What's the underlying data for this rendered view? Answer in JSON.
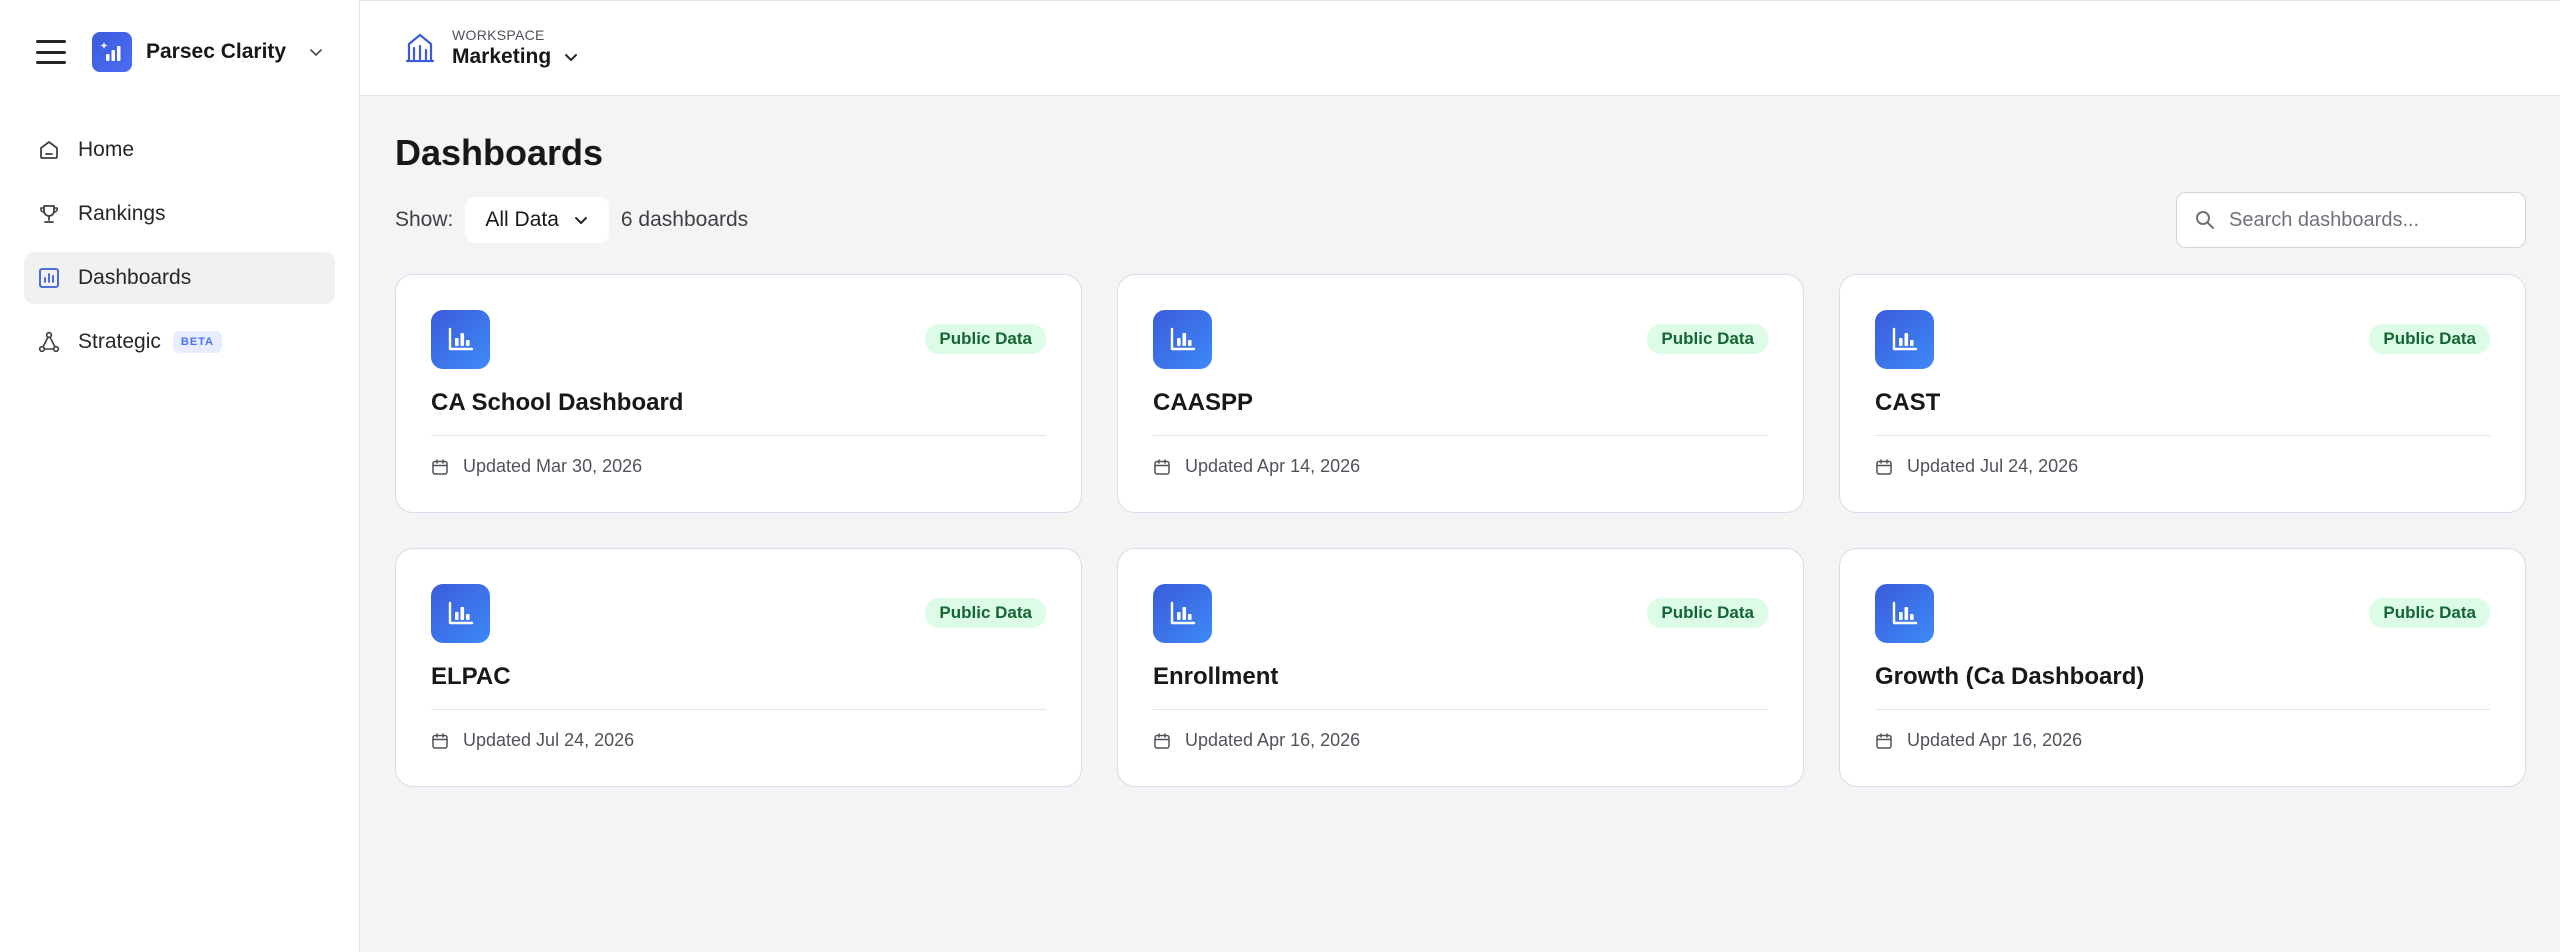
{
  "app": {
    "brand_name": "Parsec Clarity",
    "accent_color": "#4c6ef5"
  },
  "sidebar": {
    "items": [
      {
        "label": "Home",
        "icon": "home-icon",
        "active": false
      },
      {
        "label": "Rankings",
        "icon": "trophy-icon",
        "active": false
      },
      {
        "label": "Dashboards",
        "icon": "chart-icon",
        "active": true
      },
      {
        "label": "Strategic",
        "icon": "network-icon",
        "active": false,
        "badge": "BETA"
      }
    ]
  },
  "topbar": {
    "workspace_label": "WORKSPACE",
    "workspace_name": "Marketing"
  },
  "main": {
    "title": "Dashboards",
    "show_label": "Show:",
    "filter_value": "All Data",
    "count_text": "6 dashboards",
    "search_placeholder": "Search dashboards..."
  },
  "cards": [
    {
      "title": "CA School Dashboard",
      "badge": "Public Data",
      "updated": "Updated Mar 30, 2026"
    },
    {
      "title": "CAASPP",
      "badge": "Public Data",
      "updated": "Updated Apr 14, 2026"
    },
    {
      "title": "CAST",
      "badge": "Public Data",
      "updated": "Updated Jul 24, 2026"
    },
    {
      "title": "ELPAC",
      "badge": "Public Data",
      "updated": "Updated Jul 24, 2026"
    },
    {
      "title": "Enrollment",
      "badge": "Public Data",
      "updated": "Updated Apr 16, 2026"
    },
    {
      "title": "Growth (Ca Dashboard)",
      "badge": "Public Data",
      "updated": "Updated Apr 16, 2026"
    }
  ]
}
